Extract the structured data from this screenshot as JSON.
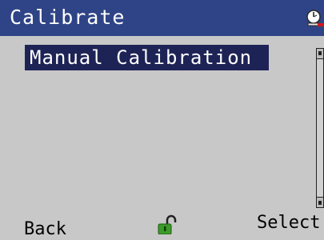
{
  "header": {
    "title": "Calibrate",
    "status_icon": "gauge-icon"
  },
  "menu": {
    "items": [
      {
        "label": "Manual Calibration",
        "selected": true
      }
    ]
  },
  "softkeys": {
    "left": "Back",
    "center_icon": "unlocked-padlock-icon",
    "right": "Select"
  },
  "colors": {
    "title_bar": "#2f4486",
    "selection": "#1e2356",
    "background": "#c8c8c8",
    "lock": "#3d9a2a",
    "alert": "#d01818"
  }
}
